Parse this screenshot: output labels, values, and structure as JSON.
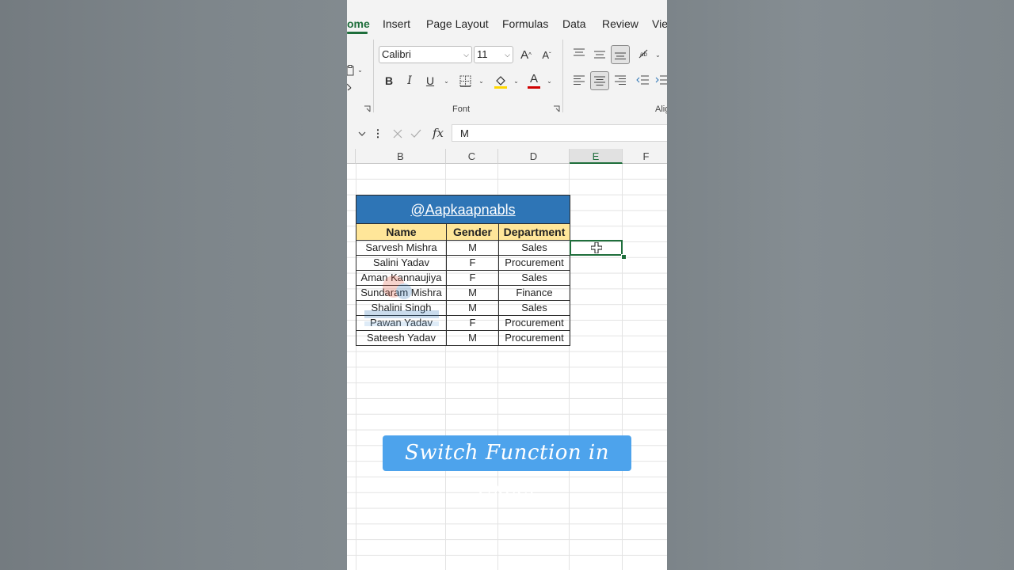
{
  "ribbon_tabs": [
    {
      "label": "ome",
      "active": true
    },
    {
      "label": "Insert",
      "active": false
    },
    {
      "label": "Page Layout",
      "active": false
    },
    {
      "label": "Formulas",
      "active": false
    },
    {
      "label": "Data",
      "active": false
    },
    {
      "label": "Review",
      "active": false
    },
    {
      "label": "Vie",
      "active": false
    }
  ],
  "font_group": {
    "font_name": "Calibri",
    "font_size": "11",
    "group_label": "Font",
    "bold": "B",
    "italic": "I",
    "underline": "U",
    "font_color_letter": "A",
    "grow_font": "A",
    "shrink_font": "A"
  },
  "alignment_group": {
    "group_label": "Alig"
  },
  "formula_bar": {
    "fx_label": "fx",
    "value": "M"
  },
  "column_headers": [
    "B",
    "C",
    "D",
    "E",
    "F"
  ],
  "selected_column": "E",
  "table": {
    "title": "@Aapkaapnabls",
    "headers": [
      "Name",
      "Gender",
      "Department"
    ],
    "rows": [
      [
        "Sarvesh Mishra",
        "M",
        "Sales"
      ],
      [
        "Salini Yadav",
        "F",
        "Procurement"
      ],
      [
        "Aman Kannaujiya",
        "F",
        "Sales"
      ],
      [
        "Sundaram Mishra",
        "M",
        "Finance"
      ],
      [
        "Shalini Singh",
        "M",
        "Sales"
      ],
      [
        "Pawan Yadav",
        "F",
        "Procurement"
      ],
      [
        "Sateesh Yadav",
        "M",
        "Procurement"
      ]
    ]
  },
  "banner": {
    "text": "Switch Function in Excel"
  },
  "colors": {
    "accent_green": "#1e6e3b",
    "title_blue": "#2e75b6",
    "header_yellow": "#ffe699",
    "banner_blue": "#4da3ec",
    "fill_highlight": "#ffd700",
    "font_color_red": "#d00000"
  }
}
